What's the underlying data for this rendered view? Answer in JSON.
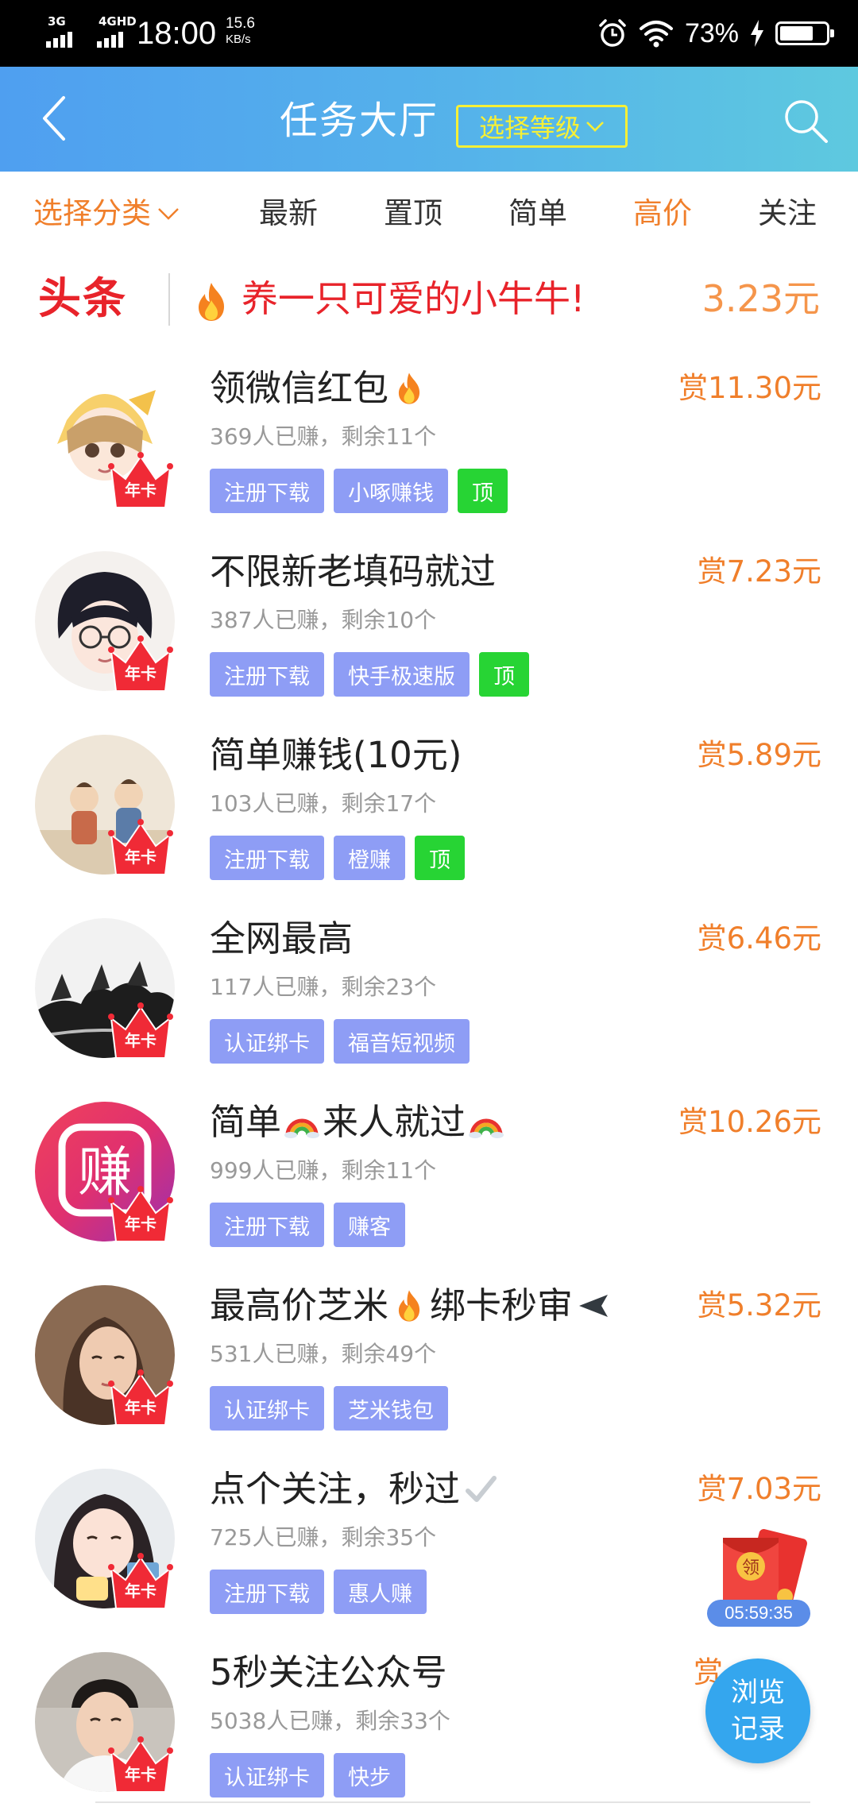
{
  "status_bar": {
    "net1": "3G",
    "net2": "4GHD",
    "time": "18:00",
    "speed_value": "15.6",
    "speed_unit": "KB/s",
    "battery_pct": "73%",
    "battery_level": 0.73,
    "icons": [
      "alarm-icon",
      "wifi-icon",
      "charging-icon",
      "battery-icon"
    ]
  },
  "header": {
    "title": "任务大厅",
    "level_select": "选择等级",
    "back_icon": "chevron-left-icon",
    "search_icon": "search-icon"
  },
  "tabs": [
    {
      "label": "选择分类",
      "highlight": true
    },
    {
      "label": "最新",
      "highlight": false
    },
    {
      "label": "置顶",
      "highlight": false
    },
    {
      "label": "简单",
      "highlight": false
    },
    {
      "label": "高价",
      "highlight": true
    },
    {
      "label": "关注",
      "highlight": false
    }
  ],
  "headline": {
    "logo": "头条",
    "text": "养一只可爱的小牛牛!",
    "price": "3.23元"
  },
  "badge_label": "年卡",
  "tasks": [
    {
      "title": "领微信红包",
      "emoji": "fire-icon",
      "subtitle": "369人已赚，剩余11个",
      "reward": "赏11.30元",
      "tags": [
        "注册下载",
        "小啄赚钱"
      ],
      "top": "顶"
    },
    {
      "title": "不限新老填码就过",
      "subtitle": "387人已赚，剩余10个",
      "reward": "赏7.23元",
      "tags": [
        "注册下载",
        "快手极速版"
      ],
      "top": "顶"
    },
    {
      "title": "简单赚钱(10元)",
      "subtitle": "103人已赚，剩余17个",
      "reward": "赏5.89元",
      "tags": [
        "注册下载",
        "橙赚"
      ],
      "top": "顶"
    },
    {
      "title": "全网最高",
      "subtitle": "117人已赚，剩余23个",
      "reward": "赏6.46元",
      "tags": [
        "认证绑卡",
        "福音短视频"
      ]
    },
    {
      "title_a": "简单",
      "title_b": "来人就过",
      "subtitle": "999人已赚，剩余11个",
      "reward": "赏10.26元",
      "tags": [
        "注册下载",
        "赚客"
      ],
      "avatar_text": "赚"
    },
    {
      "title_a": "最高价芝米",
      "title_b": "绑卡秒审",
      "subtitle": "531人已赚，剩余49个",
      "reward": "赏5.32元",
      "tags": [
        "认证绑卡",
        "芝米钱包"
      ]
    },
    {
      "title": "点个关注，秒过",
      "subtitle": "725人已赚，剩余35个",
      "reward": "赏7.03元",
      "tags": [
        "注册下载",
        "惠人赚"
      ]
    },
    {
      "title": "5秒关注公众号",
      "subtitle": "5038人已赚，剩余33个",
      "reward": "赏",
      "tags": [
        "认证绑卡",
        "快步"
      ]
    }
  ],
  "float": {
    "packet_label": "领",
    "countdown": "05:59:35",
    "history_line1": "浏览",
    "history_line2": "记录"
  }
}
